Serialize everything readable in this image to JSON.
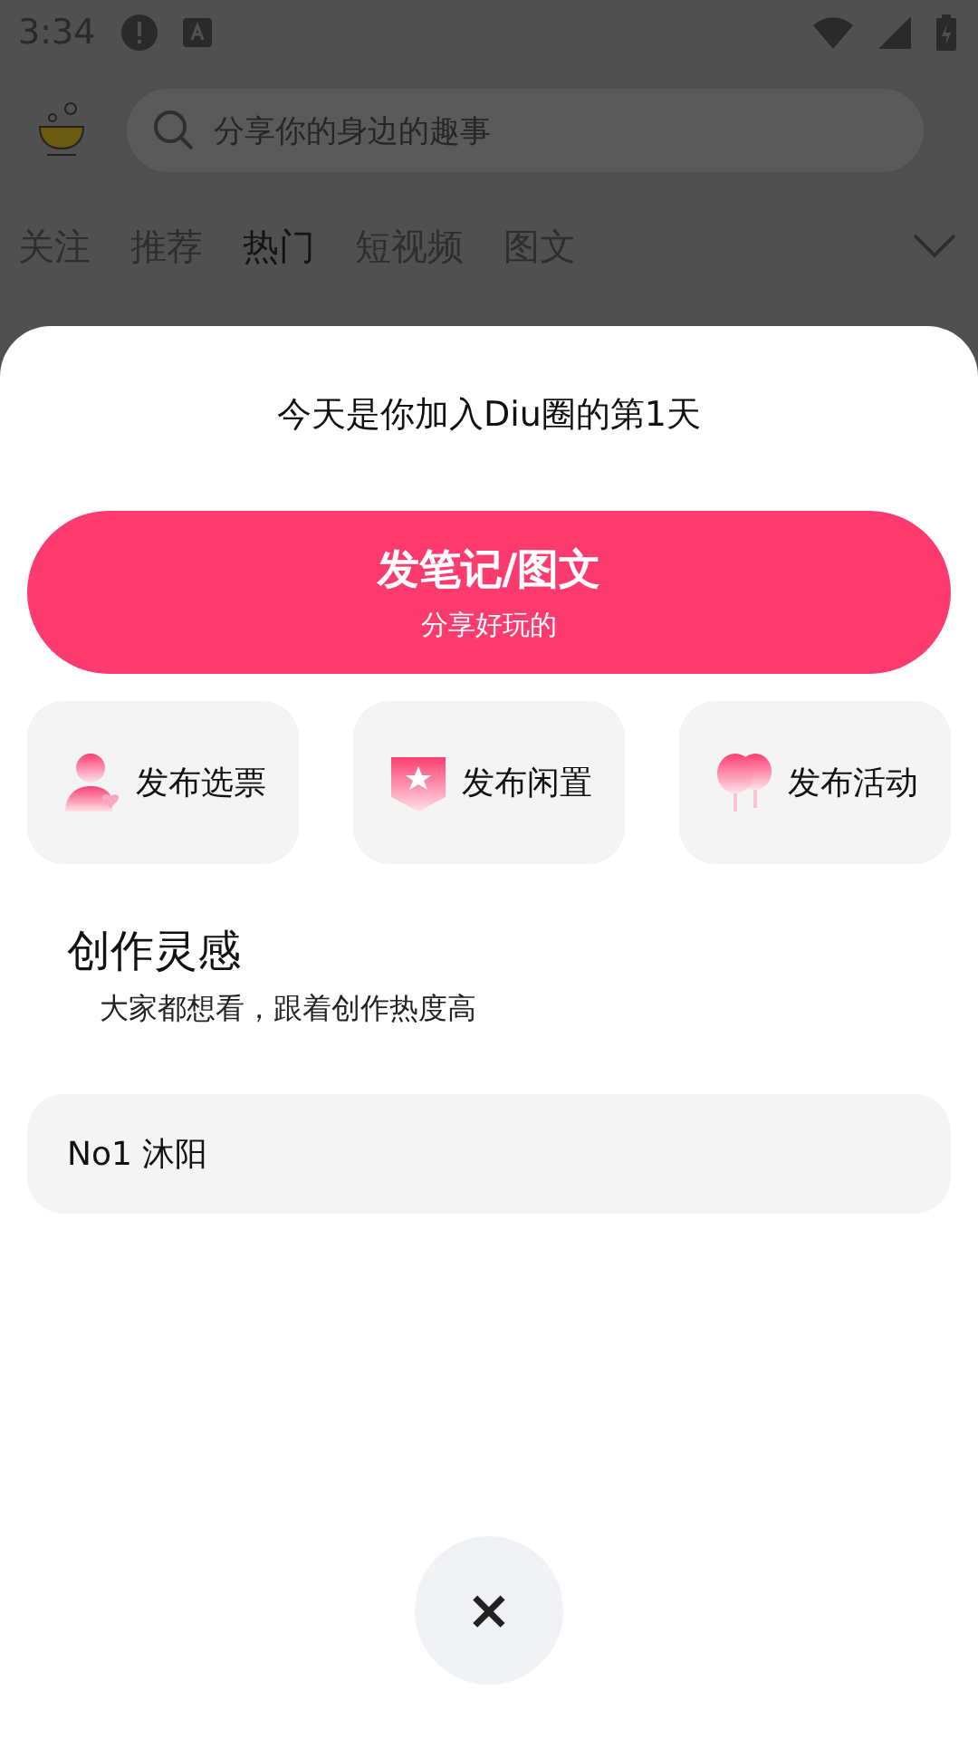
{
  "status_bar": {
    "time": "3:34"
  },
  "search": {
    "placeholder": "分享你的身边的趣事"
  },
  "tabs": [
    {
      "label": "关注",
      "selected": false
    },
    {
      "label": "推荐",
      "selected": false
    },
    {
      "label": "热门",
      "selected": true
    },
    {
      "label": "短视频",
      "selected": false
    },
    {
      "label": "图文",
      "selected": false
    }
  ],
  "sheet": {
    "greeting": "今天是你加入Diu圈的第1天",
    "main_action": {
      "title": "发笔记/图文",
      "subtitle": "分享好玩的"
    },
    "actions": [
      {
        "kind": "vote",
        "label": "发布选票"
      },
      {
        "kind": "idle",
        "label": "发布闲置"
      },
      {
        "kind": "event",
        "label": "发布活动"
      }
    ],
    "section": {
      "title": "创作灵感",
      "subtitle": "大家都想看，跟着创作热度高"
    },
    "topics": [
      {
        "label": "No1 沐阳"
      }
    ],
    "close": "×"
  }
}
